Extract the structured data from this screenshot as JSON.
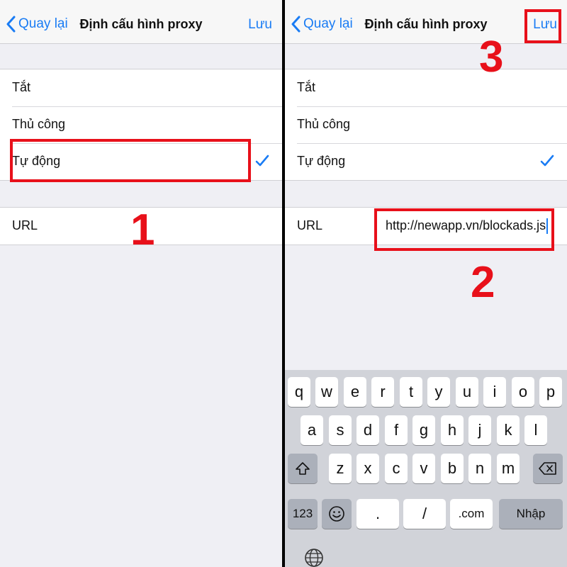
{
  "nav": {
    "back_label": "Quay lại",
    "title": "Định cấu hình proxy",
    "save_label": "Lưu"
  },
  "options": [
    {
      "label": "Tắt",
      "selected": false
    },
    {
      "label": "Thủ công",
      "selected": false
    },
    {
      "label": "Tự động",
      "selected": true
    }
  ],
  "url": {
    "label": "URL",
    "value": "http://newapp.vn/blockads.js"
  },
  "annotations": {
    "step1": "1",
    "step2": "2",
    "step3": "3",
    "highlight_color": "#e8101a"
  },
  "keyboard": {
    "row1": [
      "q",
      "w",
      "e",
      "r",
      "t",
      "y",
      "u",
      "i",
      "o",
      "p"
    ],
    "row2": [
      "a",
      "s",
      "d",
      "f",
      "g",
      "h",
      "j",
      "k",
      "l"
    ],
    "row3": [
      "z",
      "x",
      "c",
      "v",
      "b",
      "n",
      "m"
    ],
    "numbers_label": "123",
    "dot_label": ".",
    "slash_label": "/",
    "com_label": ".com",
    "return_label": "Nhập"
  },
  "colors": {
    "accent": "#1a7cf4",
    "background": "#efeff4"
  }
}
